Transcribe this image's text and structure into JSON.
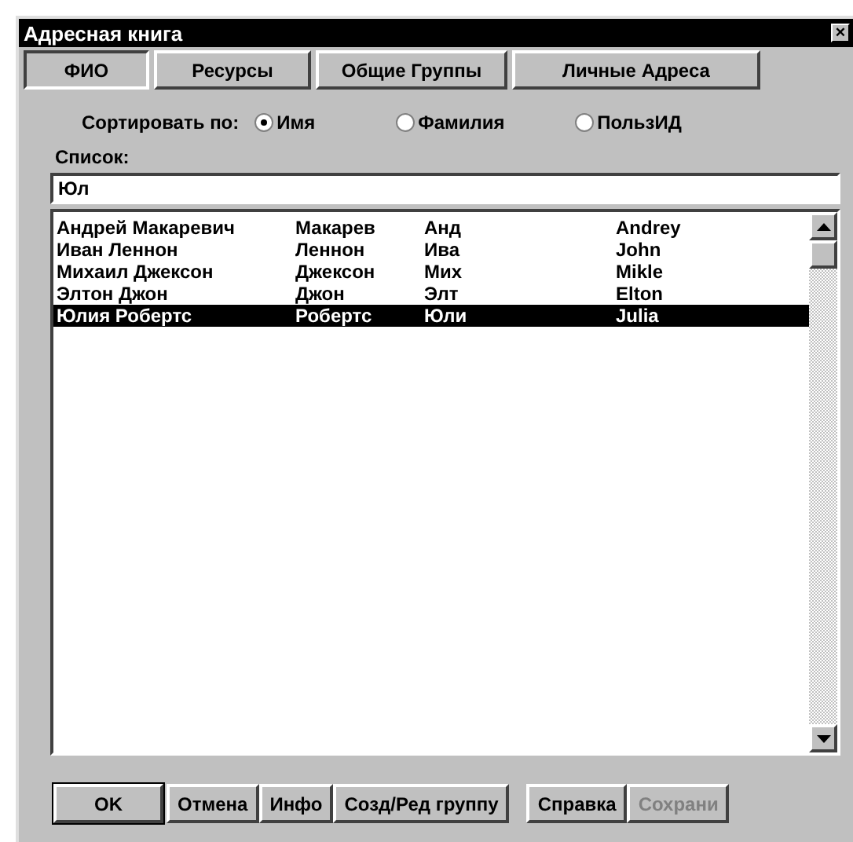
{
  "window": {
    "title": "Адресная книга",
    "close": "×"
  },
  "tabs": [
    {
      "label": "ФИО",
      "selected": true
    },
    {
      "label": "Ресурсы",
      "selected": false
    },
    {
      "label": "Общие Группы",
      "selected": false
    },
    {
      "label": "Личные Адреса",
      "selected": false
    }
  ],
  "sort": {
    "label": "Сортировать по:",
    "options": [
      {
        "label": "Имя",
        "selected": true
      },
      {
        "label": "Фамилия",
        "selected": false
      },
      {
        "label": "ПользИД",
        "selected": false
      }
    ]
  },
  "list": {
    "label": "Список:",
    "search_value": "Юл",
    "rows": [
      {
        "name": "Андрей Макаревич",
        "column_2": "Макарев",
        "column_3": "Анд",
        "column_4": "Andrey",
        "selected": false
      },
      {
        "name": "Иван Леннон",
        "column_2": "Леннон",
        "column_3": "Ива",
        "column_4": "John",
        "selected": false
      },
      {
        "name": "Михаил Джексон",
        "column_2": "Джексон",
        "column_3": "Мих",
        "column_4": "Mikle",
        "selected": false
      },
      {
        "name": "Элтон Джон",
        "column_2": "Джон",
        "column_3": "Элт",
        "column_4": "Elton",
        "selected": false
      },
      {
        "name": "Юлия Робертс",
        "column_2": "Робертс",
        "column_3": "Юли",
        "column_4": "Julia",
        "selected": true
      }
    ]
  },
  "buttons": [
    {
      "label": "OK",
      "disabled": false,
      "default": true
    },
    {
      "label": "Отмена",
      "disabled": false,
      "default": false
    },
    {
      "label": "Инфо",
      "disabled": false,
      "default": false
    },
    {
      "label": "Созд/Ред группу",
      "disabled": false,
      "default": false
    },
    {
      "label": "Справка",
      "disabled": false,
      "default": false
    },
    {
      "label": "Сохрани",
      "disabled": true,
      "default": false
    }
  ]
}
